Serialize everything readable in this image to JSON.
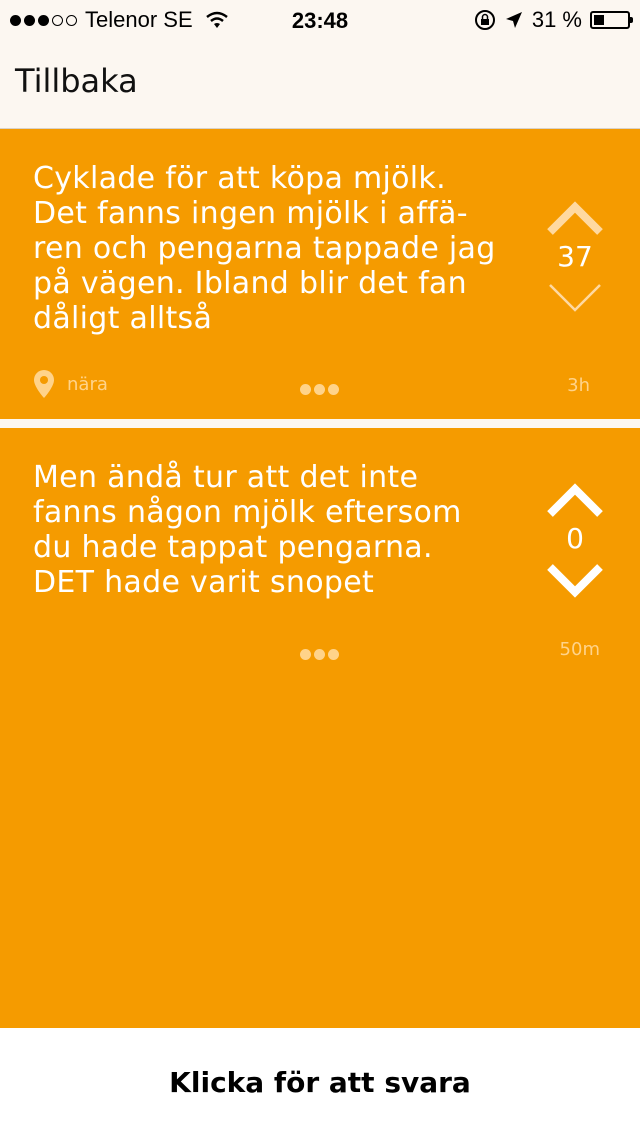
{
  "status_bar": {
    "carrier": "Telenor SE",
    "time": "23:48",
    "battery": "31 %",
    "battery_level": 0.31
  },
  "nav": {
    "back_label": "Tillbaka"
  },
  "post": {
    "text": "Cyklade för att köpa mjölk.\nDet fanns ingen mjölk i affä-\nren och pengarna tappade jag\npå vägen. Ibland blir det fan\ndåligt alltså",
    "votes": "37",
    "location": "nära",
    "age": "3h"
  },
  "replies": [
    {
      "text": "Men ändå tur att det inte\nfanns någon mjölk eftersom\ndu hade tappat pengarna.\nDET hade varit snopet",
      "votes": "0",
      "age": "50m"
    }
  ],
  "footer": {
    "reply_label": "Klicka för att svara"
  },
  "colors": {
    "post_bg": "#f59b00",
    "bar_bg": "#fcf7f1",
    "meta": "#ffd38a"
  }
}
